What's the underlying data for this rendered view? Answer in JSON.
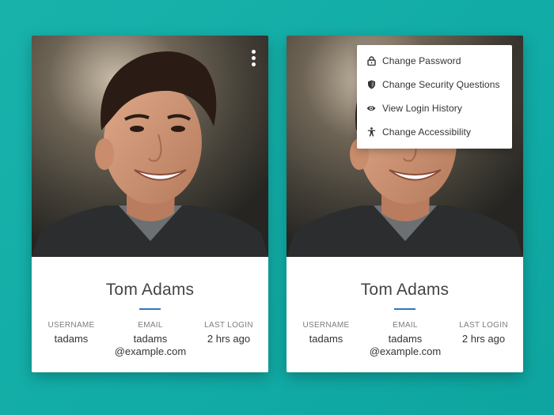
{
  "colors": {
    "background": "#16aca6",
    "accent": "#2f76c7",
    "card": "#ffffff"
  },
  "profile": {
    "name": "Tom Adams",
    "fields": [
      {
        "label": "USERNAME",
        "value": "tadams",
        "value_line2": ""
      },
      {
        "label": "EMAIL",
        "value": "tadams",
        "value_line2": "@example.com"
      },
      {
        "label": "LAST LOGIN",
        "value": "2 hrs ago",
        "value_line2": ""
      }
    ]
  },
  "menu": {
    "items": [
      {
        "label": "Change Password",
        "icon": "lock-icon"
      },
      {
        "label": "Change Security Questions",
        "icon": "shield-icon"
      },
      {
        "label": "View Login History",
        "icon": "eye-icon"
      },
      {
        "label": "Change Accessibility",
        "icon": "accessibility-icon"
      }
    ]
  }
}
